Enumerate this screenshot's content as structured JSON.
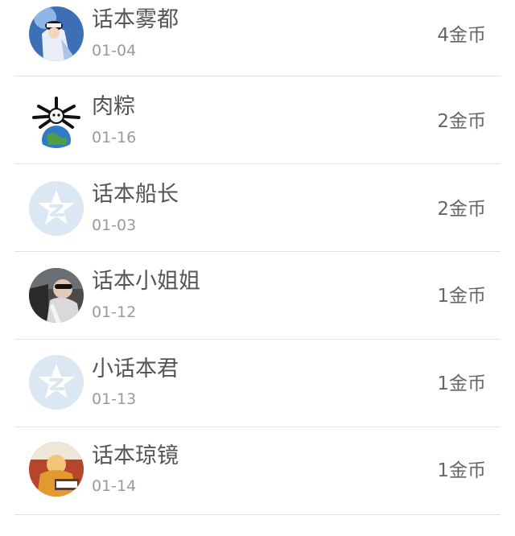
{
  "gift_list": {
    "items": [
      {
        "name": "话本雾都",
        "date": "01-04",
        "coins": "4金币",
        "avatar_icon": "user-photo-avatar-icon"
      },
      {
        "name": "肉粽",
        "date": "01-16",
        "coins": "2金币",
        "avatar_icon": "cartoon-earth-avatar-icon"
      },
      {
        "name": "话本船长",
        "date": "01-03",
        "coins": "2金币",
        "avatar_icon": "default-qzone-star-avatar-icon"
      },
      {
        "name": "话本小姐姐",
        "date": "01-12",
        "coins": "1金币",
        "avatar_icon": "user-photo-avatar-icon"
      },
      {
        "name": "小话本君",
        "date": "01-13",
        "coins": "1金币",
        "avatar_icon": "default-qzone-star-avatar-icon"
      },
      {
        "name": "话本琼镜",
        "date": "01-14",
        "coins": "1金币",
        "avatar_icon": "user-photo-avatar-icon"
      }
    ]
  },
  "colors": {
    "name_text": "#555555",
    "date_text": "#9a9a9a",
    "coins_text": "#666666",
    "divider": "#e3e3e3",
    "default_avatar_bg": "#dbe8f3"
  }
}
